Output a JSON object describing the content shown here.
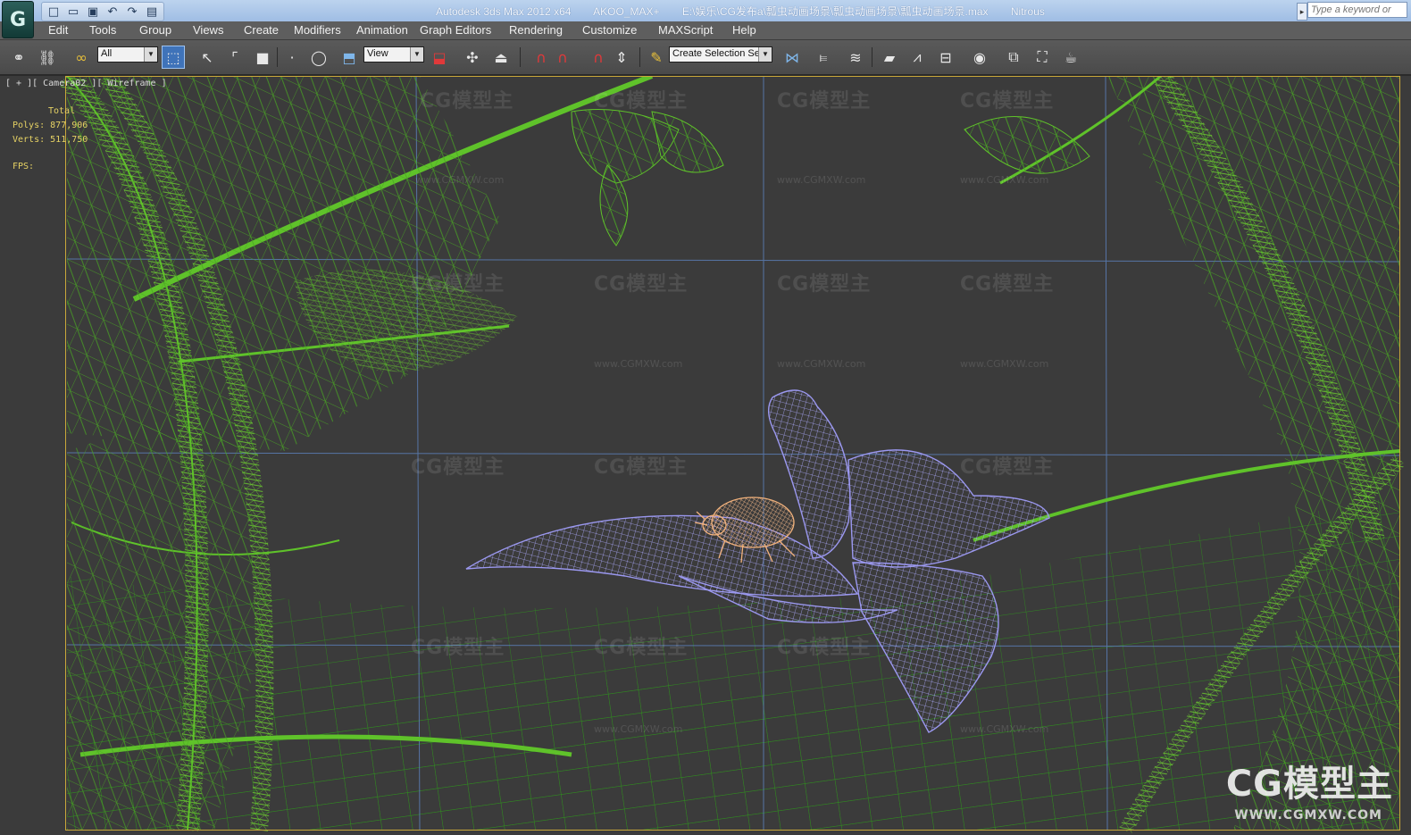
{
  "titlebar": {
    "logo_glyph": "G",
    "app_title": "Autodesk 3ds Max  2012 x64",
    "workspace": "AKOO_MAX+",
    "file_path": "E:\\娱乐\\CG发布a\\瓢虫动画场景\\瓢虫动画场景\\瓢虫动画场景.max",
    "renderer": "Nitrous",
    "search_placeholder": "Type a keyword or"
  },
  "quick_access": [
    {
      "icon": "new-file-icon",
      "glyph": "□"
    },
    {
      "icon": "open-folder-icon",
      "glyph": "▭"
    },
    {
      "icon": "save-icon",
      "glyph": "▣"
    },
    {
      "icon": "undo-icon",
      "glyph": "↶"
    },
    {
      "icon": "redo-icon",
      "glyph": "↷"
    },
    {
      "icon": "project-folder-icon",
      "glyph": "▤"
    }
  ],
  "menu": [
    "Edit",
    "Tools",
    "Group",
    "Views",
    "Create",
    "Modifiers",
    "Animation",
    "Graph Editors",
    "Rendering",
    "Customize",
    "MAXScript",
    "Help"
  ],
  "toolbar": {
    "selection_filter": "All",
    "reference_coord": "View",
    "named_selection": "Create Selection Se"
  },
  "viewport": {
    "label": "[ + ][ Camera02 ][ Wireframe ]",
    "stats_header": "Total",
    "polys_label": "Polys:",
    "polys_value": "877,906",
    "verts_label": "Verts:",
    "verts_value": "511,750",
    "fps_label": "FPS:",
    "watermark": "CG模型主",
    "watermark_url": "www.CGMXW.com",
    "corner_logo": "CG模型主",
    "corner_url": "WWW.CGMXW.COM"
  },
  "colors": {
    "foliage_wire": "#5fc22a",
    "foliage_dark": "#2f7d1d",
    "flower_wire": "#9b98f0",
    "ladybug_wire": "#f2b27c",
    "grid_line": "#5b7fb8",
    "safe_frame": "#caa83a"
  }
}
